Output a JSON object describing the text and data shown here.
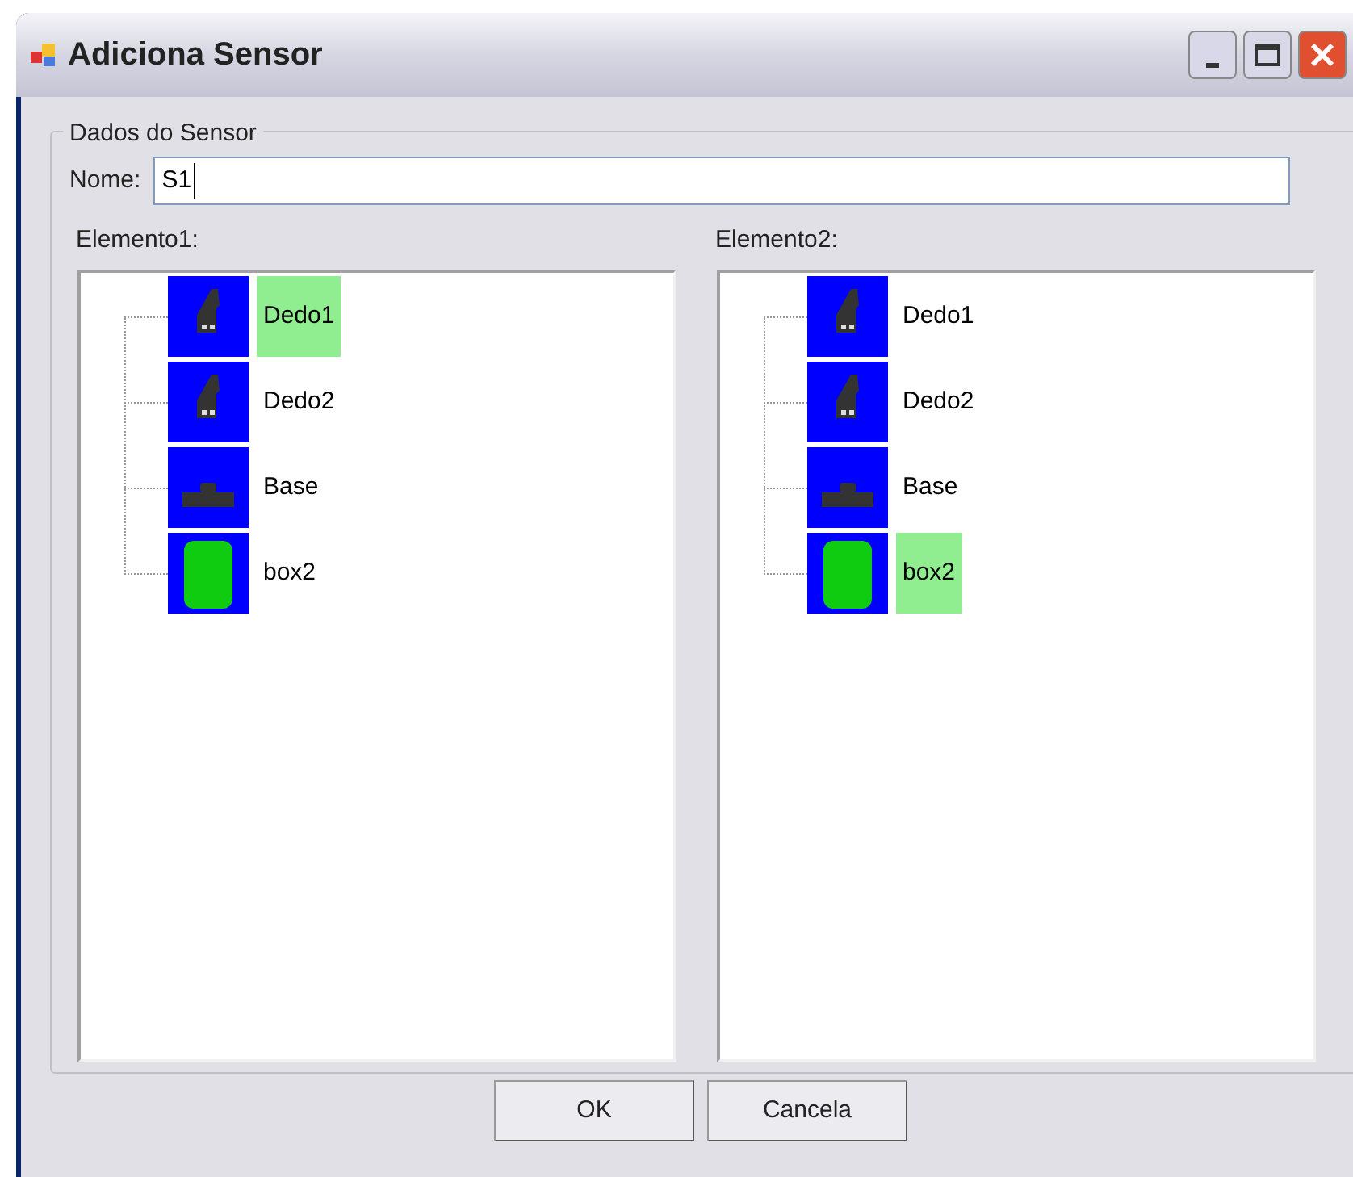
{
  "window": {
    "title": "Adiciona Sensor"
  },
  "group": {
    "title": "Dados do Sensor",
    "name_label": "Nome:",
    "name_value": "S1"
  },
  "trees": [
    {
      "label": "Elemento1:",
      "items": [
        {
          "label": "Dedo1",
          "kind": "finger",
          "selected": true
        },
        {
          "label": "Dedo2",
          "kind": "finger",
          "selected": false
        },
        {
          "label": "Base",
          "kind": "base",
          "selected": false
        },
        {
          "label": "box2",
          "kind": "box",
          "selected": false
        }
      ]
    },
    {
      "label": "Elemento2:",
      "items": [
        {
          "label": "Dedo1",
          "kind": "finger",
          "selected": false
        },
        {
          "label": "Dedo2",
          "kind": "finger",
          "selected": false
        },
        {
          "label": "Base",
          "kind": "base",
          "selected": false
        },
        {
          "label": "box2",
          "kind": "box",
          "selected": true
        }
      ]
    }
  ],
  "buttons": [
    "OK",
    "Cancela"
  ]
}
